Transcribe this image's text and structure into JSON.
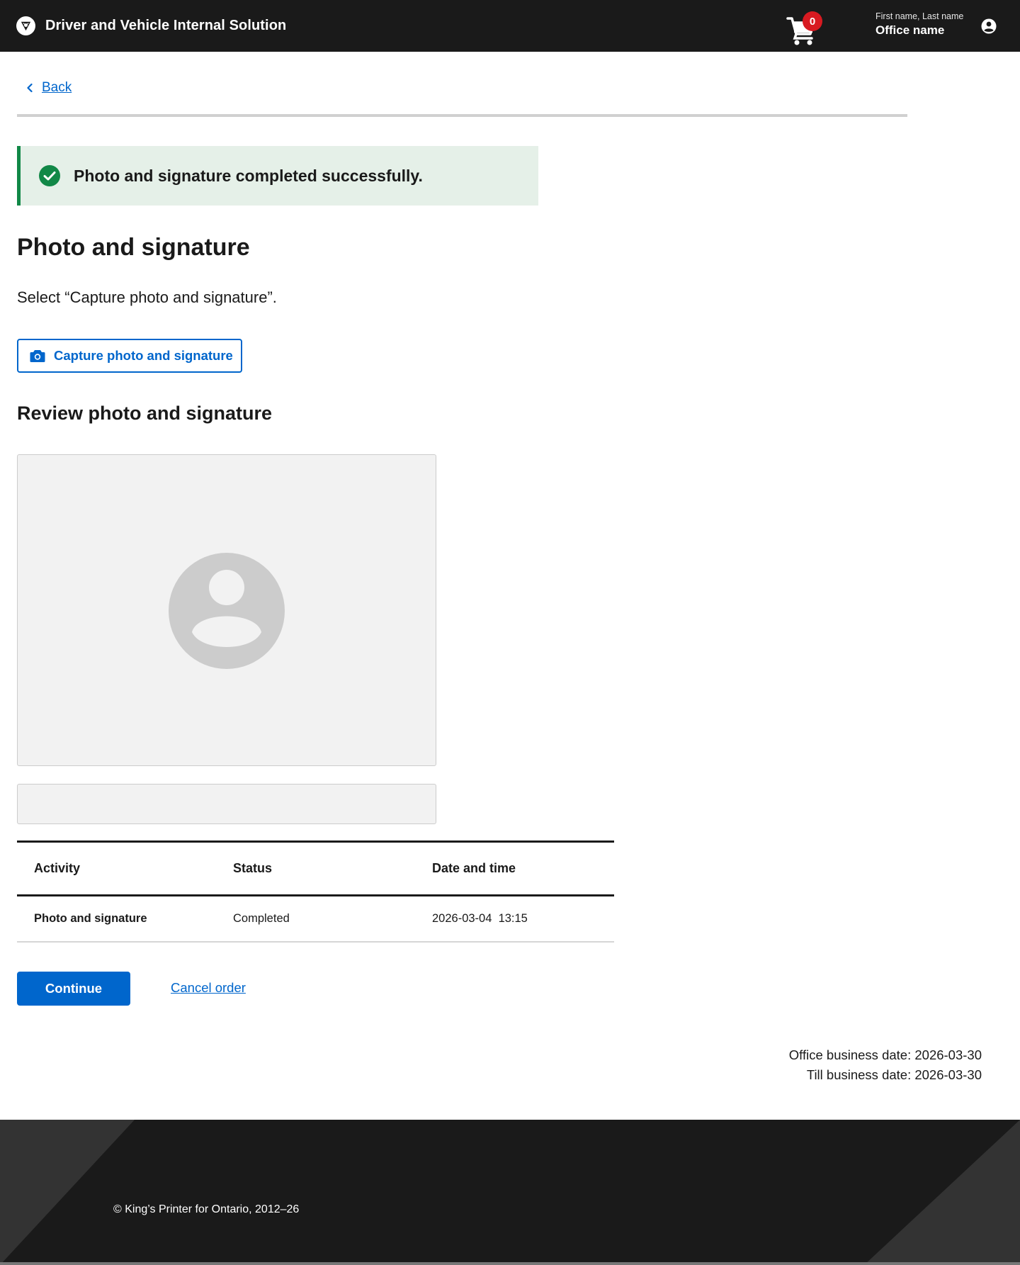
{
  "header": {
    "app_title": "Driver and Vehicle Internal Solution",
    "cart_count": "0",
    "user_name": "First name, Last name",
    "office_name": "Office name"
  },
  "nav": {
    "back_label": "Back"
  },
  "alert": {
    "message": "Photo and signature completed successfully."
  },
  "main": {
    "title": "Photo and signature",
    "instructions": "Select “Capture photo and signature”.",
    "capture_button": "Capture photo and signature",
    "review_title": "Review photo and signature"
  },
  "table": {
    "headers": [
      "Activity",
      "Status",
      "Date and time"
    ],
    "rows": [
      [
        "Photo and signature",
        "Completed",
        "2026-03-04  13:15"
      ]
    ]
  },
  "actions": {
    "continue_label": "Continue",
    "cancel_label": "Cancel order"
  },
  "dates": {
    "office_business_date": "Office business date: 2026-03-30",
    "till_business_date": "Till business date: 2026-03-30"
  },
  "footer": {
    "copyright": "© King’s Printer for Ontario, 2012–26"
  },
  "colors": {
    "header_bg": "#1a1a1a",
    "accent": "#0066cc",
    "success": "#118847",
    "success_bg": "#e5f0e8",
    "badge": "#d81a21"
  },
  "icons": [
    "trillium-logo-icon",
    "cart-icon",
    "account-icon",
    "chevron-left-icon",
    "check-circle-icon",
    "camera-icon",
    "avatar-placeholder-icon"
  ]
}
